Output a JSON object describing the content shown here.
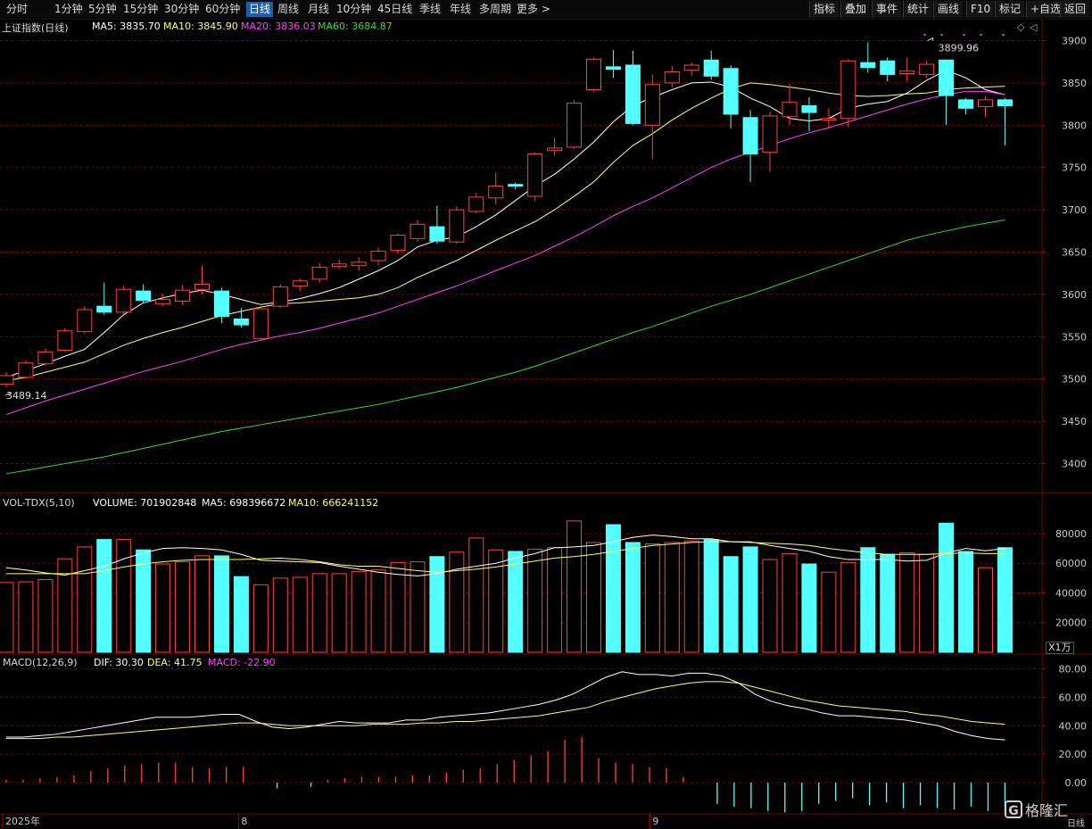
{
  "toolbar": {
    "periods": [
      "分时",
      "1分钟",
      "5分钟",
      "15分钟",
      "30分钟",
      "60分钟",
      "日线",
      "周线",
      "月线",
      "10分钟",
      "45日线",
      "季线",
      "年线",
      "多周期",
      "更多 >"
    ],
    "active_period": "日线",
    "right_buttons": [
      "指标",
      "叠加",
      "事件",
      "统计",
      "画线",
      "F10",
      "标记",
      "+自选",
      "返回"
    ]
  },
  "main_legend": {
    "title": "上证指数(日线)",
    "ma5": "MA5: 3835.70",
    "ma10": "MA10: 3845.90",
    "ma20": "MA20: 3836.03",
    "ma60": "MA60: 3684.87"
  },
  "vol_legend": {
    "title": "VOL-TDX(5,10)",
    "volume": "VOLUME: 701902848",
    "ma5": "MA5: 698396672",
    "ma10": "MA10: 666241152"
  },
  "macd_legend": {
    "title": "MACD(12,26,9)",
    "dif": "DIF: 30.30",
    "dea": "DEA: 41.75",
    "macd": "MACD: -22.90"
  },
  "annotations": {
    "high": "3899.96",
    "low": "3489.14"
  },
  "vol_unit": "X1万",
  "date_labels": [
    {
      "text": "2025年",
      "idx": 0
    },
    {
      "text": "8",
      "idx": 12
    },
    {
      "text": "9",
      "idx": 33
    }
  ],
  "corner_label": "日线",
  "watermark": "格隆汇",
  "colors": {
    "up": "#ff4040",
    "down": "#54ffff",
    "ma5": "#ffffff",
    "ma10": "#ffff66",
    "ma20": "#ff40ff",
    "ma60": "#33dd33",
    "grid": "#7a0000"
  },
  "chart_data": [
    {
      "type": "candlestick",
      "title": "上证指数(日线)",
      "y_ticks": [
        3400,
        3450,
        3500,
        3550,
        3600,
        3650,
        3700,
        3750,
        3800,
        3850,
        3900
      ],
      "ylim": [
        3370,
        3910
      ],
      "candles": [
        [
          3494,
          3504,
          3490,
          3508
        ],
        [
          3502,
          3519,
          3500,
          3522
        ],
        [
          3518,
          3532,
          3516,
          3536
        ],
        [
          3534,
          3557,
          3532,
          3560
        ],
        [
          3556,
          3582,
          3554,
          3586
        ],
        [
          3586,
          3579,
          3576,
          3614
        ],
        [
          3579,
          3606,
          3576,
          3610
        ],
        [
          3604,
          3593,
          3590,
          3612
        ],
        [
          3589,
          3594,
          3586,
          3600
        ],
        [
          3592,
          3605,
          3588,
          3611
        ],
        [
          3606,
          3612,
          3600,
          3634
        ],
        [
          3604,
          3574,
          3566,
          3608
        ],
        [
          3571,
          3564,
          3561,
          3584
        ],
        [
          3548,
          3583,
          3546,
          3584
        ],
        [
          3586,
          3609,
          3584,
          3612
        ],
        [
          3610,
          3616,
          3604,
          3619
        ],
        [
          3618,
          3632,
          3614,
          3637
        ],
        [
          3633,
          3636,
          3630,
          3641
        ],
        [
          3634,
          3638,
          3628,
          3644
        ],
        [
          3640,
          3651,
          3634,
          3656
        ],
        [
          3652,
          3670,
          3648,
          3672
        ],
        [
          3666,
          3683,
          3662,
          3688
        ],
        [
          3680,
          3663,
          3660,
          3705
        ],
        [
          3662,
          3700,
          3660,
          3704
        ],
        [
          3698,
          3715,
          3696,
          3720
        ],
        [
          3714,
          3728,
          3706,
          3744
        ],
        [
          3730,
          3728,
          3724,
          3732
        ],
        [
          3716,
          3766,
          3710,
          3768
        ],
        [
          3770,
          3773,
          3764,
          3785
        ],
        [
          3774,
          3826,
          3772,
          3830
        ],
        [
          3842,
          3878,
          3839,
          3880
        ],
        [
          3869,
          3866,
          3856,
          3889
        ],
        [
          3871,
          3802,
          3800,
          3888
        ],
        [
          3800,
          3848,
          3760,
          3860
        ],
        [
          3850,
          3863,
          3845,
          3870
        ],
        [
          3865,
          3871,
          3858,
          3874
        ],
        [
          3877,
          3858,
          3854,
          3888
        ],
        [
          3867,
          3813,
          3796,
          3871
        ],
        [
          3809,
          3766,
          3733,
          3818
        ],
        [
          3768,
          3811,
          3745,
          3816
        ],
        [
          3810,
          3827,
          3800,
          3849
        ],
        [
          3823,
          3815,
          3793,
          3833
        ],
        [
          3806,
          3808,
          3796,
          3820
        ],
        [
          3808,
          3876,
          3798,
          3878
        ],
        [
          3874,
          3868,
          3862,
          3898
        ],
        [
          3876,
          3860,
          3852,
          3880
        ],
        [
          3861,
          3864,
          3852,
          3880
        ],
        [
          3860,
          3872,
          3856,
          3876
        ],
        [
          3877,
          3835,
          3800,
          3877
        ],
        [
          3830,
          3820,
          3813,
          3832
        ],
        [
          3822,
          3830,
          3810,
          3834
        ],
        [
          3830,
          3823,
          3776,
          3832
        ]
      ],
      "ma": {
        "MA5": [
          3502,
          3510,
          3518,
          3527,
          3535,
          3555,
          3576,
          3590,
          3596,
          3601,
          3605,
          3600,
          3594,
          3588,
          3591,
          3595,
          3601,
          3608,
          3618,
          3628,
          3640,
          3656,
          3664,
          3668,
          3680,
          3694,
          3711,
          3728,
          3742,
          3760,
          3780,
          3804,
          3823,
          3833,
          3842,
          3850,
          3851,
          3845,
          3832,
          3822,
          3808,
          3805,
          3808,
          3820,
          3825,
          3828,
          3838,
          3853,
          3865,
          3856,
          3842,
          3836
        ],
        "MA10": [
          3498,
          3502,
          3508,
          3514,
          3520,
          3530,
          3540,
          3548,
          3555,
          3561,
          3568,
          3575,
          3580,
          3585,
          3589,
          3590,
          3592,
          3594,
          3596,
          3600,
          3608,
          3620,
          3630,
          3640,
          3652,
          3664,
          3675,
          3686,
          3700,
          3716,
          3733,
          3756,
          3776,
          3790,
          3806,
          3820,
          3832,
          3843,
          3850,
          3848,
          3845,
          3842,
          3838,
          3835,
          3834,
          3835,
          3837,
          3838,
          3842,
          3844,
          3845,
          3846
        ],
        "MA20": [
          3458,
          3466,
          3474,
          3481,
          3488,
          3495,
          3502,
          3509,
          3515,
          3521,
          3528,
          3535,
          3541,
          3546,
          3551,
          3555,
          3560,
          3566,
          3572,
          3578,
          3586,
          3594,
          3602,
          3610,
          3619,
          3628,
          3637,
          3646,
          3657,
          3668,
          3680,
          3693,
          3704,
          3714,
          3726,
          3738,
          3750,
          3760,
          3768,
          3776,
          3784,
          3791,
          3797,
          3804,
          3811,
          3818,
          3825,
          3831,
          3836,
          3840,
          3840,
          3836
        ],
        "MA60": [
          3388,
          3392,
          3396,
          3400,
          3404,
          3408,
          3413,
          3418,
          3423,
          3428,
          3433,
          3438,
          3442,
          3446,
          3450,
          3454,
          3458,
          3462,
          3466,
          3470,
          3475,
          3480,
          3485,
          3490,
          3496,
          3502,
          3508,
          3515,
          3523,
          3531,
          3539,
          3547,
          3555,
          3562,
          3570,
          3578,
          3586,
          3593,
          3600,
          3608,
          3616,
          3624,
          3632,
          3640,
          3648,
          3656,
          3664,
          3670,
          3675,
          3680,
          3684,
          3688
        ]
      }
    },
    {
      "type": "bar",
      "title": "VOL-TDX(5,10)",
      "unit": "X1万",
      "y_ticks": [
        20000,
        40000,
        60000,
        80000
      ],
      "ylim": [
        0,
        92000
      ],
      "volumes": [
        47000,
        47500,
        49000,
        63000,
        71000,
        76000,
        76000,
        69000,
        59500,
        61000,
        65000,
        65000,
        51000,
        45500,
        50000,
        50500,
        53000,
        53000,
        54500,
        55500,
        60500,
        61000,
        64500,
        67500,
        77000,
        69000,
        68000,
        69500,
        70500,
        88500,
        74000,
        86000,
        74000,
        73000,
        74000,
        75000,
        76000,
        64500,
        71000,
        62500,
        66500,
        59500,
        54000,
        60500,
        70500,
        66000,
        67000,
        66000,
        87000,
        68000,
        57000,
        70500
      ],
      "ma5": [
        57000,
        55500,
        53500,
        52000,
        55000,
        58000,
        63000,
        67000,
        70000,
        70500,
        70000,
        69000,
        66000,
        62000,
        61500,
        61000,
        60500,
        58000,
        56000,
        54000,
        52500,
        51500,
        53000,
        56000,
        58000,
        60000,
        63500,
        66500,
        70500,
        71000,
        72000,
        74500,
        77500,
        79000,
        78000,
        76500,
        76500,
        74500,
        74500,
        72000,
        70000,
        68000,
        64500,
        62500,
        62500,
        62500,
        61500,
        62000,
        67000,
        70000,
        68500,
        70000
      ],
      "ma10": [
        53000,
        53000,
        53000,
        53000,
        53000,
        55000,
        57500,
        59500,
        61000,
        62000,
        62500,
        62500,
        62500,
        63000,
        63500,
        62500,
        61000,
        59000,
        58000,
        58000,
        56500,
        55000,
        54000,
        55000,
        56000,
        57500,
        59500,
        61500,
        63500,
        64500,
        66000,
        68000,
        70000,
        72000,
        73000,
        74000,
        74500,
        74500,
        74000,
        73500,
        73000,
        72000,
        70000,
        68500,
        67000,
        66000,
        66000,
        66000,
        66500,
        67000,
        66500,
        66500
      ]
    },
    {
      "type": "macd",
      "title": "MACD(12,26,9)",
      "y_ticks": [
        0,
        20,
        40,
        60,
        80
      ],
      "ylim": [
        -22,
        86
      ],
      "dif": [
        32,
        32,
        33,
        34,
        36,
        38,
        40,
        42,
        44,
        46,
        46,
        46,
        47,
        48,
        48,
        43,
        39,
        38,
        39,
        41,
        43,
        42,
        42,
        42,
        44,
        44,
        46,
        47,
        48,
        49,
        51,
        53,
        55,
        58,
        62,
        68,
        74,
        78,
        76,
        76,
        75,
        77,
        77,
        75,
        70,
        62,
        57,
        54,
        52,
        49,
        47,
        47,
        46,
        45,
        44,
        42,
        40,
        36,
        33,
        31,
        30
      ],
      "dea": [
        31,
        31,
        31,
        32,
        32,
        33,
        34,
        35,
        36,
        37,
        38,
        39,
        40,
        41,
        42,
        42,
        41,
        40,
        40,
        40,
        40,
        40,
        41,
        41,
        41,
        42,
        42,
        43,
        43,
        44,
        45,
        46,
        47,
        49,
        51,
        53,
        57,
        60,
        63,
        66,
        68,
        70,
        71,
        71,
        70,
        67,
        64,
        61,
        58,
        56,
        54,
        53,
        52,
        51,
        50,
        48,
        47,
        45,
        43,
        42,
        41
      ],
      "macd_bars": [
        2,
        2,
        3,
        4,
        5,
        8,
        10,
        12,
        13,
        14,
        14,
        11,
        10,
        11,
        11,
        0,
        -4,
        0,
        -3,
        2,
        3,
        4,
        4,
        4,
        5,
        5,
        7,
        9,
        10,
        13,
        16,
        19,
        22,
        30,
        32,
        17,
        14,
        13,
        11,
        10,
        4,
        0,
        -15,
        -17,
        -18,
        -20,
        -21,
        -20,
        -15,
        -13,
        -11,
        -16,
        -14,
        -18,
        -16,
        -18,
        -19,
        -17,
        -20,
        -22
      ]
    }
  ]
}
